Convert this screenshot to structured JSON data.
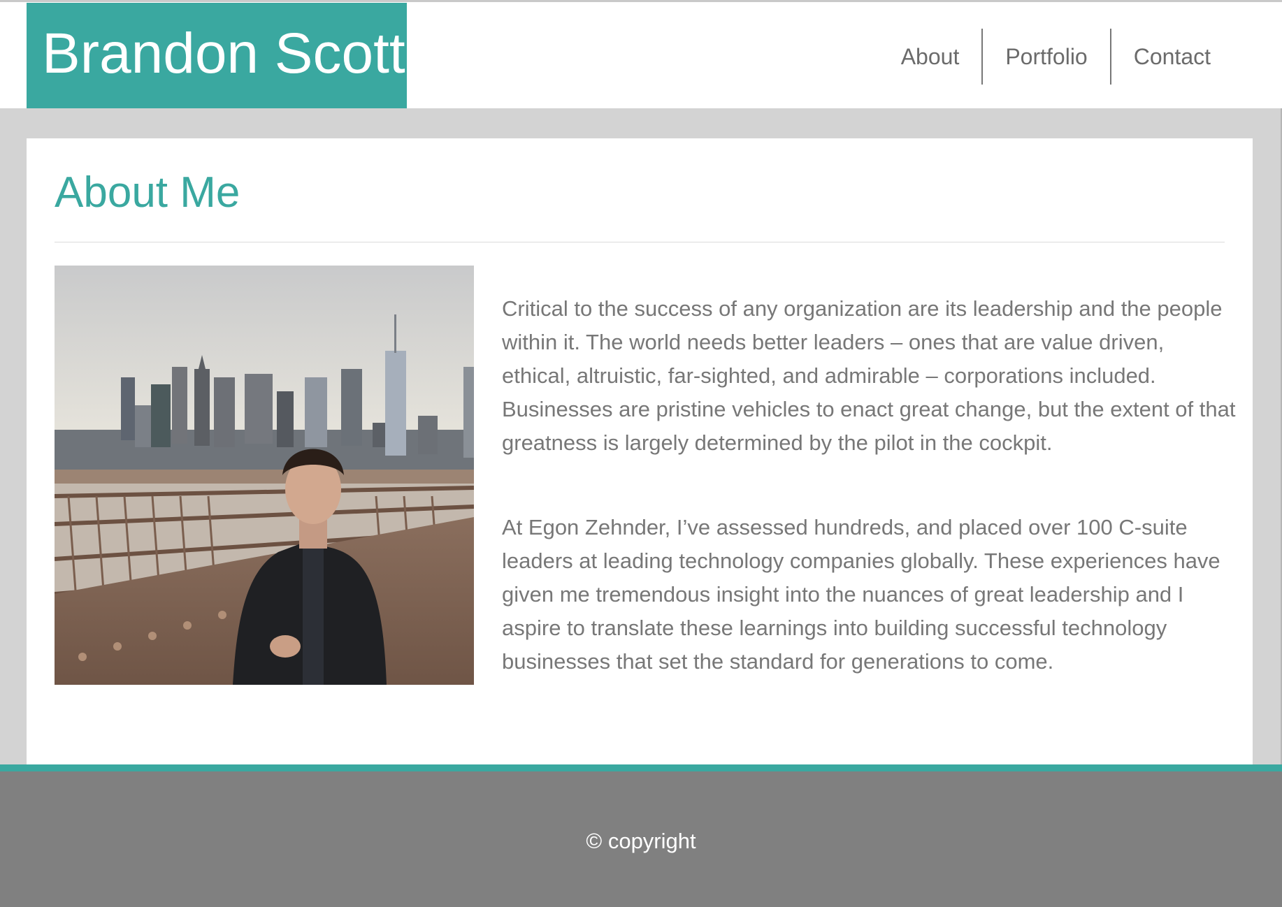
{
  "header": {
    "brand": "Brandon Scott",
    "nav": [
      {
        "label": "About"
      },
      {
        "label": "Portfolio"
      },
      {
        "label": "Contact"
      }
    ]
  },
  "main": {
    "title": "About Me",
    "photo_alt": "Man standing on a bridge in front of a city skyline",
    "paragraphs": [
      "Critical to the success of any organization are its leadership and the people within it. The world needs better leaders – ones that are value driven, ethical, altruistic, far-sighted, and admirable – corporations included. Businesses are pristine vehicles to enact great change, but the extent of that greatness is largely determined by the pilot in the cockpit.",
      "At Egon Zehnder, I’ve assessed hundreds, and placed over 100 C-suite leaders at leading technology companies globally. These experiences have given me tremendous insight into the nuances of great leadership and I aspire to translate these learnings into building successful technology businesses that set the standard for generations to come."
    ]
  },
  "footer": {
    "copyright": "© copyright"
  },
  "colors": {
    "accent": "#3aa8a0",
    "page_bg": "#d3d3d3",
    "footer_bg": "#808080",
    "text": "#777777",
    "nav_text": "#6b6b6b"
  }
}
